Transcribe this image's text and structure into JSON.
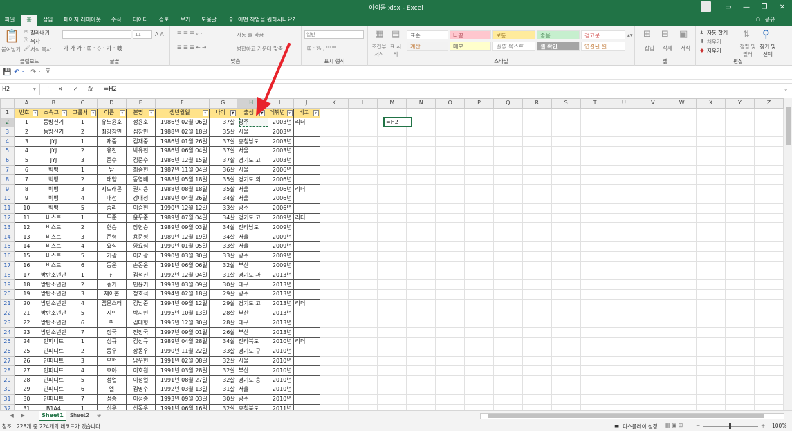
{
  "window": {
    "title": "아이돌.xlsx - Excel",
    "user": "공유"
  },
  "tabs": [
    "파일",
    "홈",
    "삽입",
    "페이지 레이아웃",
    "수식",
    "데이터",
    "검토",
    "보기",
    "도움말"
  ],
  "tell_me": "어떤 작업을 원하시나요?",
  "ribbon": {
    "clipboard": {
      "paste": "붙여넣기",
      "cut": "잘라내기",
      "copy": "복사",
      "format_painter": "서식 복사",
      "label": "클립보드"
    },
    "font": {
      "label": "글꼴",
      "size": "11"
    },
    "align": {
      "wrap": "자동 줄 바꿈",
      "merge": "병합하고 가운데 맞춤",
      "label": "맞춤"
    },
    "number": {
      "format": "일반",
      "label": "표시 형식"
    },
    "styles": {
      "cond": "조건부 서식",
      "table": "표 서식",
      "cells": [
        "표준",
        "나쁨",
        "보통",
        "좋음",
        "경고문",
        "계산",
        "메모",
        "설명 텍스트",
        "셀 확인",
        "연결된 셀"
      ],
      "label": "스타일"
    },
    "cells": {
      "insert": "삽입",
      "delete": "삭제",
      "format": "서식",
      "label": "셀"
    },
    "edit": {
      "autosum": "자동 합계",
      "fill": "채우기",
      "clear": "지우기",
      "sort": "정렬 및 필터",
      "find": "찾기 및 선택",
      "label": "편집"
    }
  },
  "formula_bar": {
    "name": "H2",
    "formula": "=H2"
  },
  "columns": [
    "A",
    "B",
    "C",
    "D",
    "E",
    "F",
    "G",
    "H",
    "I",
    "J",
    "K",
    "L",
    "M",
    "N",
    "O",
    "P",
    "Q",
    "R",
    "S",
    "T",
    "U",
    "V",
    "W",
    "X",
    "Y",
    "Z"
  ],
  "headers": [
    "번호",
    "소속그",
    "그룹서",
    "이름",
    "본명",
    "생년월일",
    "나이",
    "출생",
    "데뷔년",
    "비고"
  ],
  "rows": [
    [
      "1",
      "동방신기",
      "1",
      "유노윤호",
      "정윤호",
      "1986년 02월 06일",
      "37살",
      "광주",
      "2003년",
      "리더"
    ],
    [
      "2",
      "동방신기",
      "2",
      "최강창민",
      "심창민",
      "1988년 02월 18일",
      "35살",
      "서울",
      "2003년",
      ""
    ],
    [
      "3",
      "JYJ",
      "1",
      "재중",
      "김재중",
      "1986년 01월 26일",
      "37살",
      "충청남도",
      "2003년",
      ""
    ],
    [
      "4",
      "JYJ",
      "2",
      "유천",
      "박유천",
      "1986년 06월 04일",
      "37살",
      "서울",
      "2003년",
      ""
    ],
    [
      "5",
      "JYJ",
      "3",
      "준수",
      "김준수",
      "1986년 12월 15일",
      "37살",
      "경기도 고",
      "2003년",
      ""
    ],
    [
      "6",
      "빅뱅",
      "1",
      "탑",
      "최승현",
      "1987년 11월 04일",
      "36살",
      "서울",
      "2006년",
      ""
    ],
    [
      "7",
      "빅뱅",
      "2",
      "태양",
      "동영배",
      "1988년 05월 18일",
      "35살",
      "경기도 의",
      "2006년",
      ""
    ],
    [
      "8",
      "빅뱅",
      "3",
      "지드래곤",
      "권지용",
      "1988년 08월 18일",
      "35살",
      "서울",
      "2006년",
      "리더"
    ],
    [
      "9",
      "빅뱅",
      "4",
      "대성",
      "강대성",
      "1989년 04월 26일",
      "34살",
      "서울",
      "2006년",
      ""
    ],
    [
      "10",
      "빅뱅",
      "5",
      "승리",
      "이승현",
      "1990년 12월 12일",
      "33살",
      "광주",
      "2006년",
      ""
    ],
    [
      "11",
      "비스트",
      "1",
      "두준",
      "윤두준",
      "1989년 07월 04일",
      "34살",
      "경기도 고",
      "2009년",
      "리더"
    ],
    [
      "12",
      "비스트",
      "2",
      "현승",
      "장현승",
      "1989년 09월 03일",
      "34살",
      "전라남도",
      "2009년",
      ""
    ],
    [
      "13",
      "비스트",
      "3",
      "준형",
      "용준형",
      "1989년 12월 19일",
      "34살",
      "서울",
      "2009년",
      ""
    ],
    [
      "14",
      "비스트",
      "4",
      "요섭",
      "양요섭",
      "1990년 01월 05일",
      "33살",
      "서울",
      "2009년",
      ""
    ],
    [
      "15",
      "비스트",
      "5",
      "기광",
      "이기광",
      "1990년 03월 30일",
      "33살",
      "광주",
      "2009년",
      ""
    ],
    [
      "16",
      "비스트",
      "6",
      "동운",
      "손동운",
      "1991년 06월 06일",
      "32살",
      "부산",
      "2009년",
      ""
    ],
    [
      "17",
      "방탄소년단",
      "1",
      "진",
      "김석진",
      "1992년 12월 04일",
      "31살",
      "경기도 과",
      "2013년",
      ""
    ],
    [
      "18",
      "방탄소년단",
      "2",
      "슈가",
      "민윤기",
      "1993년 03월 09일",
      "30살",
      "대구",
      "2013년",
      ""
    ],
    [
      "19",
      "방탄소년단",
      "3",
      "제이홉",
      "정호석",
      "1994년 02월 18일",
      "29살",
      "광주",
      "2013년",
      ""
    ],
    [
      "20",
      "방탄소년단",
      "4",
      "랩몬스터",
      "김남준",
      "1994년 09월 12일",
      "29살",
      "경기도 고",
      "2013년",
      "리더"
    ],
    [
      "21",
      "방탄소년단",
      "5",
      "지민",
      "박지민",
      "1995년 10월 13일",
      "28살",
      "부산",
      "2013년",
      ""
    ],
    [
      "22",
      "방탄소년단",
      "6",
      "뷔",
      "김태형",
      "1995년 12월 30일",
      "28살",
      "대구",
      "2013년",
      ""
    ],
    [
      "23",
      "방탄소년단",
      "7",
      "정국",
      "전정국",
      "1997년 09월 01일",
      "26살",
      "부산",
      "2013년",
      ""
    ],
    [
      "24",
      "인피니트",
      "1",
      "성규",
      "김성규",
      "1989년 04월 28일",
      "34살",
      "전라북도",
      "2010년",
      "리더"
    ],
    [
      "25",
      "인피니트",
      "2",
      "동우",
      "장동우",
      "1990년 11월 22일",
      "33살",
      "경기도 구",
      "2010년",
      ""
    ],
    [
      "26",
      "인피니트",
      "3",
      "우현",
      "남우현",
      "1991년 02월 08일",
      "32살",
      "서울",
      "2010년",
      ""
    ],
    [
      "27",
      "인피니트",
      "4",
      "호야",
      "이호원",
      "1991년 03월 28일",
      "32살",
      "부산",
      "2010년",
      ""
    ],
    [
      "28",
      "인피니트",
      "5",
      "성열",
      "이성열",
      "1991년 08월 27일",
      "32살",
      "경기도 용",
      "2010년",
      ""
    ],
    [
      "29",
      "인피니트",
      "6",
      "엘",
      "김명수",
      "1992년 03월 13일",
      "31살",
      "서울",
      "2010년",
      ""
    ],
    [
      "30",
      "인피니트",
      "7",
      "성종",
      "이성종",
      "1993년 09월 03일",
      "30살",
      "광주",
      "2010년",
      ""
    ],
    [
      "31",
      "B1A4",
      "1",
      "신우",
      "신동우",
      "1991년 06월 16일",
      "32살",
      "충청북도",
      "2011년",
      ""
    ]
  ],
  "edit_cell": "=H2",
  "sheets": [
    "Sheet1",
    "Sheet2"
  ],
  "status": {
    "mode": "참조",
    "message": "228개 중 224개의 레코드가 있습니다.",
    "display": "디스플레이 설정",
    "zoom": "100%"
  },
  "accent": "#217346",
  "header_fill": "#ffe38a",
  "annotation_arrow": "#e8232b"
}
